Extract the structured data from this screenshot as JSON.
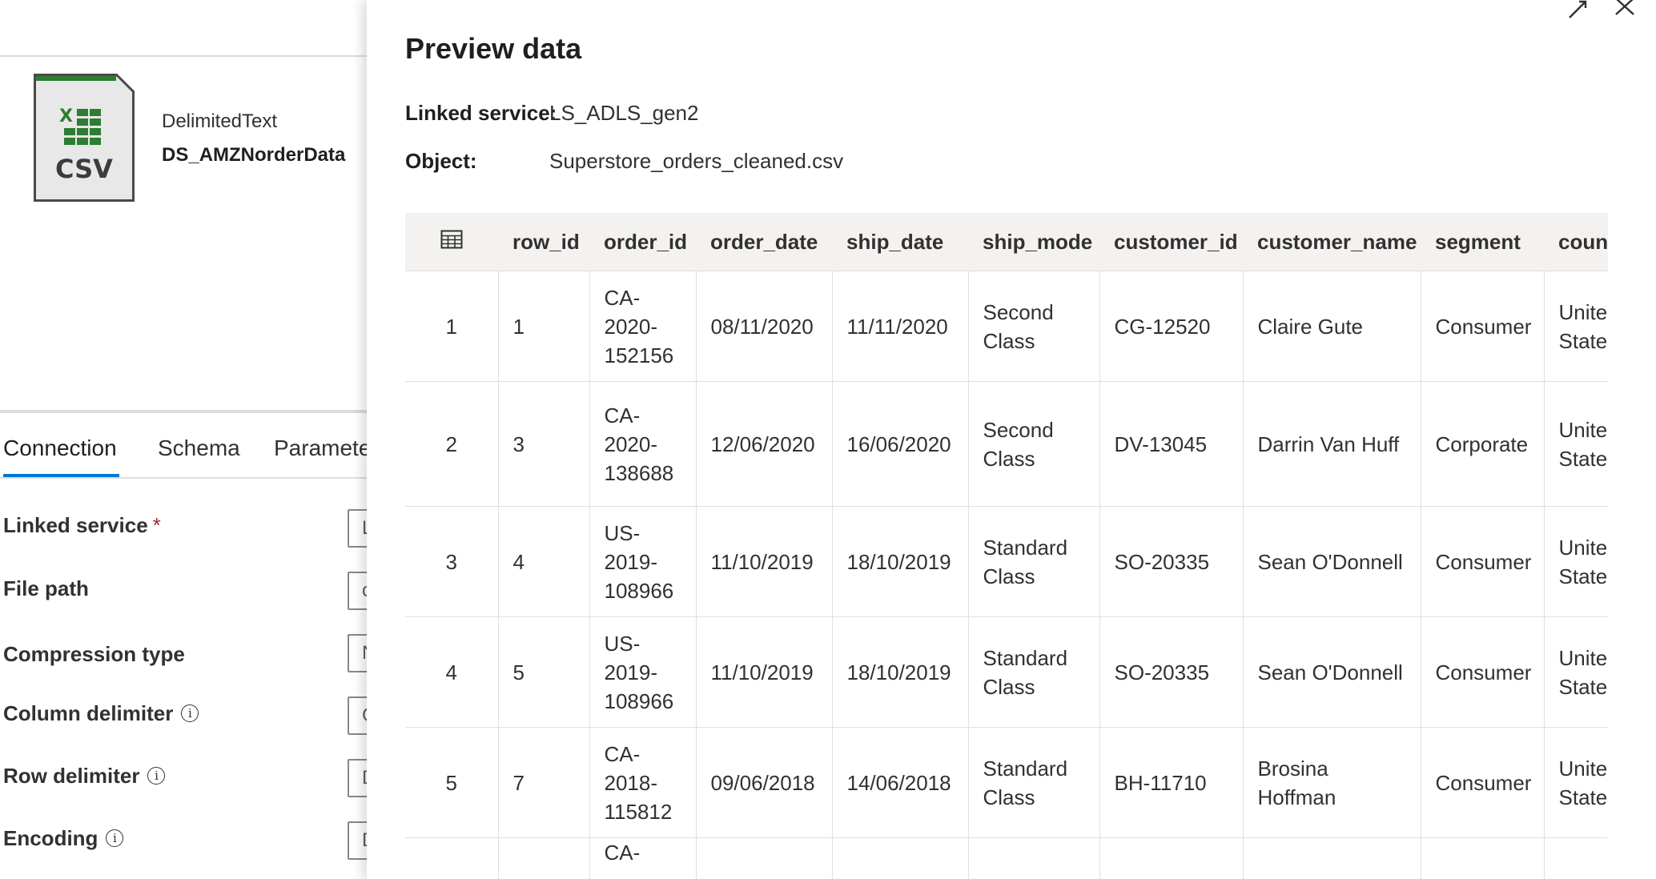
{
  "dataset": {
    "icon_label": "CSV",
    "type": "DelimitedText",
    "name": "DS_AMZNorderData"
  },
  "tabs": [
    "Connection",
    "Schema",
    "Paramete"
  ],
  "fields": [
    {
      "label": "Linked service",
      "required": true,
      "info": false,
      "value": "L"
    },
    {
      "label": "File path",
      "required": false,
      "info": false,
      "value": "c"
    },
    {
      "label": "Compression type",
      "required": false,
      "info": false,
      "value": "N"
    },
    {
      "label": "Column delimiter",
      "required": false,
      "info": true,
      "value": "C"
    },
    {
      "label": "Row delimiter",
      "required": false,
      "info": true,
      "value": "D"
    },
    {
      "label": "Encoding",
      "required": false,
      "info": true,
      "value": "D"
    }
  ],
  "preview": {
    "title": "Preview data",
    "linked_service_label": "Linked service:",
    "linked_service_value": "LS_ADLS_gen2",
    "object_label": "Object:",
    "object_value": "Superstore_orders_cleaned.csv",
    "columns": [
      "row_id",
      "order_id",
      "order_date",
      "ship_date",
      "ship_mode",
      "customer_id",
      "customer_name",
      "segment",
      "coun"
    ],
    "rows": [
      [
        "1",
        "1",
        "CA-\n2020-\n152156",
        "08/11/2020",
        "11/11/2020",
        "Second\nClass",
        "CG-12520",
        "Claire Gute",
        "Consumer",
        "Unite\nState"
      ],
      [
        "2",
        "3",
        "CA-\n2020-\n138688",
        "12/06/2020",
        "16/06/2020",
        "Second\nClass",
        "DV-13045",
        "Darrin Van Huff",
        "Corporate",
        "Unite\nState"
      ],
      [
        "3",
        "4",
        "US-\n2019-\n108966",
        "11/10/2019",
        "18/10/2019",
        "Standard\nClass",
        "SO-20335",
        "Sean O'Donnell",
        "Consumer",
        "Unite\nState"
      ],
      [
        "4",
        "5",
        "US-\n2019-\n108966",
        "11/10/2019",
        "18/10/2019",
        "Standard\nClass",
        "SO-20335",
        "Sean O'Donnell",
        "Consumer",
        "Unite\nState"
      ],
      [
        "5",
        "7",
        "CA-\n2018-\n115812",
        "09/06/2018",
        "14/06/2018",
        "Standard\nClass",
        "BH-11710",
        "Brosina\nHoffman",
        "Consumer",
        "Unite\nState"
      ],
      [
        "",
        "",
        "CA-",
        "",
        "",
        "",
        "",
        "",
        "",
        ""
      ]
    ]
  }
}
